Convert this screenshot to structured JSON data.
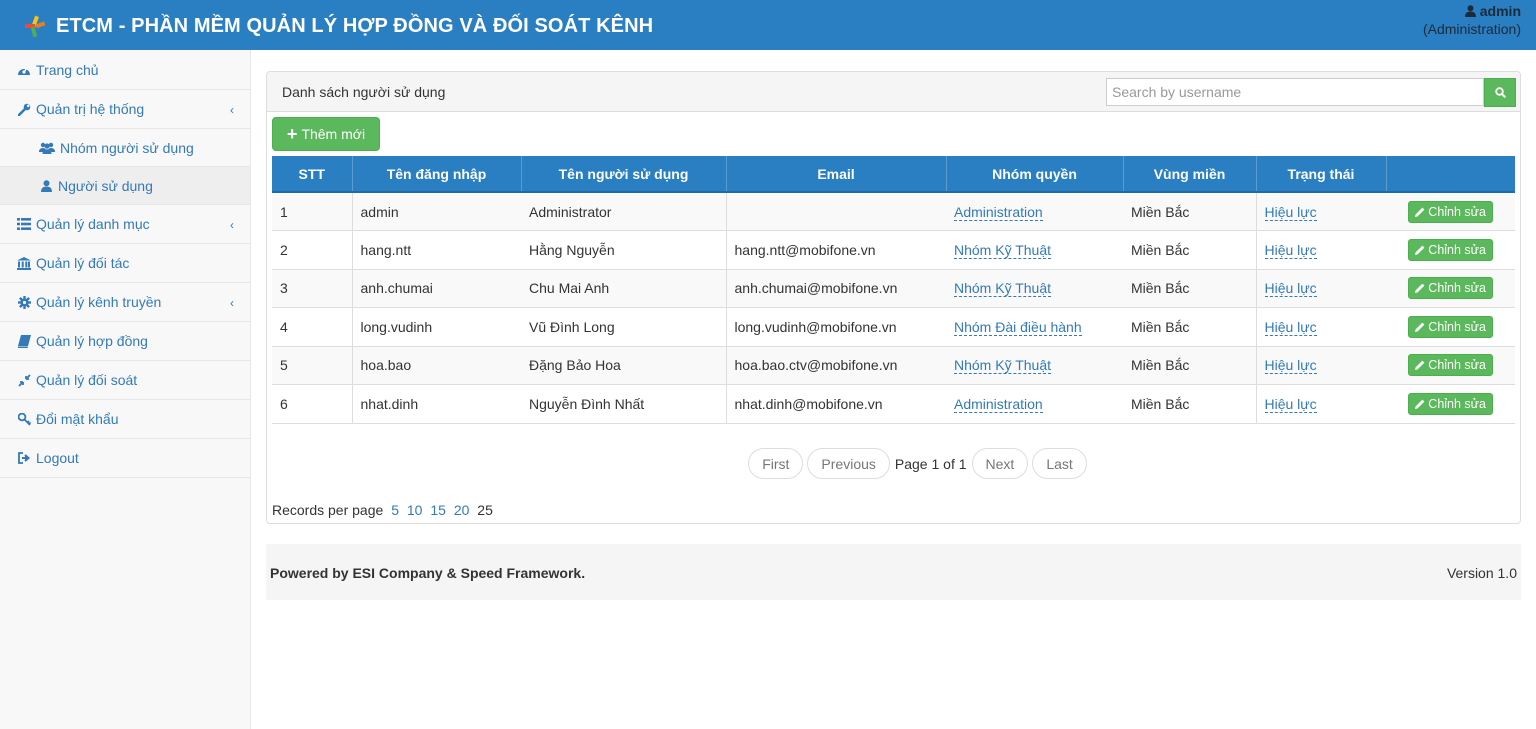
{
  "header": {
    "title": "ETCM - PHẦN MỀM QUẢN LÝ HỢP ĐỒNG VÀ ĐỐI SOÁT KÊNH",
    "user_name": "admin",
    "user_role": "(Administration)"
  },
  "sidebar": {
    "items": [
      {
        "label": "Trang chủ",
        "icon": "dashboard-icon"
      },
      {
        "label": "Quản trị hệ thống",
        "icon": "wrench-icon",
        "expanded": true
      },
      {
        "label": "Nhóm người sử dụng",
        "icon": "users-icon"
      },
      {
        "label": "Người sử dụng",
        "icon": "user-icon",
        "active": true
      },
      {
        "label": "Quản lý danh mục",
        "icon": "list-icon"
      },
      {
        "label": "Quản lý đối tác",
        "icon": "bank-icon"
      },
      {
        "label": "Quản lý kênh truyền",
        "icon": "gear-icon"
      },
      {
        "label": "Quản lý hợp đồng",
        "icon": "book-icon"
      },
      {
        "label": "Quản lý đối soát",
        "icon": "compress-icon"
      },
      {
        "label": "Đổi mật khẩu",
        "icon": "key-icon"
      },
      {
        "label": "Logout",
        "icon": "sign-out-icon"
      }
    ]
  },
  "panel": {
    "title": "Danh sách người sử dụng",
    "search_placeholder": "Search by username",
    "add_label": "Thêm mới"
  },
  "table": {
    "columns": [
      "STT",
      "Tên đăng nhập",
      "Tên người sử dụng",
      "Email",
      "Nhóm quyền",
      "Vùng miền",
      "Trạng thái",
      ""
    ],
    "edit_label": "Chỉnh sửa",
    "rows": [
      {
        "stt": "1",
        "username": "admin",
        "fullname": "Administrator",
        "email": "",
        "group": "Administration",
        "region": "Miền Bắc",
        "status": "Hiệu lực"
      },
      {
        "stt": "2",
        "username": "hang.ntt",
        "fullname": "Hằng Nguyễn",
        "email": "hang.ntt@mobifone.vn",
        "group": "Nhóm Kỹ Thuật",
        "region": "Miền Bắc",
        "status": "Hiệu lực"
      },
      {
        "stt": "3",
        "username": "anh.chumai",
        "fullname": "Chu Mai Anh",
        "email": "anh.chumai@mobifone.vn",
        "group": "Nhóm Kỹ Thuật",
        "region": "Miền Bắc",
        "status": "Hiệu lực"
      },
      {
        "stt": "4",
        "username": "long.vudinh",
        "fullname": "Vũ Đình Long",
        "email": "long.vudinh@mobifone.vn",
        "group": "Nhóm Đài điều hành",
        "region": "Miền Bắc",
        "status": "Hiệu lực"
      },
      {
        "stt": "5",
        "username": "hoa.bao",
        "fullname": "Đặng Bảo Hoa",
        "email": "hoa.bao.ctv@mobifone.vn",
        "group": "Nhóm Kỹ Thuật",
        "region": "Miền Bắc",
        "status": "Hiệu lực"
      },
      {
        "stt": "6",
        "username": "nhat.dinh",
        "fullname": "Nguyễn Đình Nhất",
        "email": "nhat.dinh@mobifone.vn",
        "group": "Administration",
        "region": "Miền Bắc",
        "status": "Hiệu lực"
      }
    ]
  },
  "pagination": {
    "first": "First",
    "previous": "Previous",
    "info": "Page 1 of 1",
    "next": "Next",
    "last": "Last"
  },
  "records": {
    "label": "Records per page",
    "options": [
      "5",
      "10",
      "15",
      "20",
      "25"
    ],
    "current": "25"
  },
  "footer": {
    "powered": "Powered by ESI Company & Speed Framework.",
    "version": "Version 1.0"
  }
}
